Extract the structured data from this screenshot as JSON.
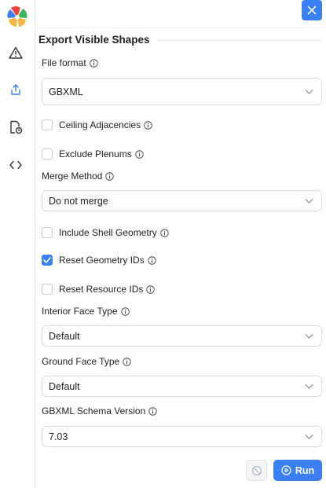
{
  "panel": {
    "title": "Export Visible Shapes"
  },
  "rail": {
    "icons": [
      "app-logo",
      "warning-icon",
      "export-icon",
      "report-icon",
      "code-icon"
    ]
  },
  "fields": {
    "file_format": {
      "label": "File format",
      "value": "GBXML"
    },
    "merge_method": {
      "label": "Merge Method",
      "value": "Do not merge"
    },
    "interior_face_type": {
      "label": "Interior Face Type",
      "value": "Default"
    },
    "ground_face_type": {
      "label": "Ground Face Type",
      "value": "Default"
    },
    "schema_version": {
      "label": "GBXML Schema Version",
      "value": "7.03"
    }
  },
  "checkboxes": {
    "ceiling_adjacencies": {
      "label": "Ceiling Adjacencies",
      "checked": false
    },
    "exclude_plenums": {
      "label": "Exclude Plenums",
      "checked": false
    },
    "include_shell_geometry": {
      "label": "Include Shell Geometry",
      "checked": false
    },
    "reset_geometry_ids": {
      "label": "Reset Geometry IDs",
      "checked": true
    },
    "reset_resource_ids": {
      "label": "Reset Resource IDs",
      "checked": false
    }
  },
  "actions": {
    "run_label": "Run"
  },
  "colors": {
    "accent": "#3b7ff5",
    "border": "#d9dce1"
  }
}
